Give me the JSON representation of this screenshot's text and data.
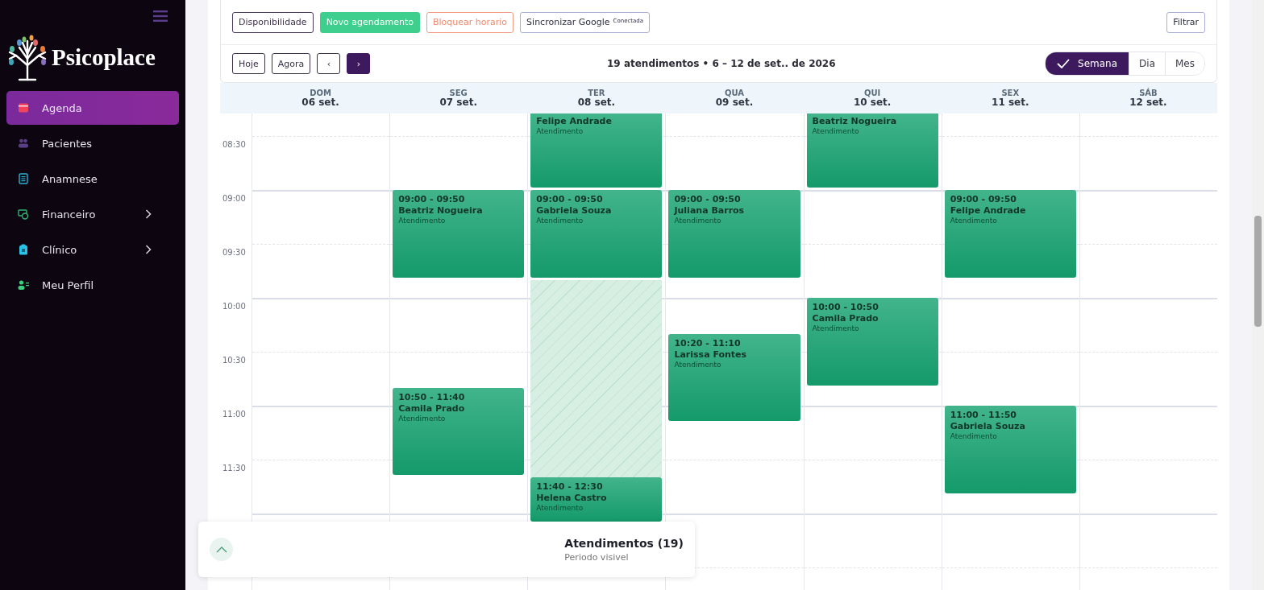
{
  "sidebar": {
    "brand": "Psicoplace",
    "items": [
      {
        "label": "Agenda",
        "selected": true,
        "expandable": false
      },
      {
        "label": "Pacientes",
        "selected": false,
        "expandable": false
      },
      {
        "label": "Anamnese",
        "selected": false,
        "expandable": false
      },
      {
        "label": "Financeiro",
        "selected": false,
        "expandable": true
      },
      {
        "label": "Clínico",
        "selected": false,
        "expandable": true
      },
      {
        "label": "Meu Perfil",
        "selected": false,
        "expandable": false
      }
    ]
  },
  "toolbar": {
    "actions": [
      {
        "label": "Disponibilidade",
        "kind": "outline"
      },
      {
        "label": "Novo agendamento",
        "kind": "primary"
      },
      {
        "label": "Bloquear horario",
        "kind": "danger"
      },
      {
        "label": "Sincronizar Google",
        "kind": "sync",
        "badge": "Conectada"
      }
    ],
    "filter": "Filtrar",
    "nav": [
      {
        "label": "Hoje",
        "kind": "text"
      },
      {
        "label": "Agora",
        "kind": "text"
      },
      {
        "label": "‹",
        "kind": "prev"
      },
      {
        "label": "›",
        "kind": "next"
      }
    ],
    "summary": "19 atendimentos • 6 – 12 de set.. de 2026",
    "views": [
      {
        "label": "Semana",
        "selected": true
      },
      {
        "label": "Dia",
        "selected": false
      },
      {
        "label": "Mes",
        "selected": false
      }
    ]
  },
  "calendar": {
    "times": [
      "08:30",
      "09:00",
      "09:30",
      "10:00",
      "10:30",
      "11:00",
      "11:30"
    ],
    "days": [
      {
        "weekday": "DOM",
        "date": "06 set."
      },
      {
        "weekday": "SEG",
        "date": "07 set.",
        "events": [
          {
            "kind": "appointment",
            "time": "09:00 - 09:50",
            "name": "Beatriz Nogueira",
            "type": "Atendimento"
          },
          {
            "kind": "appointment",
            "time": "10:50 - 11:40",
            "name": "Camila Prado",
            "type": "Atendimento"
          }
        ]
      },
      {
        "weekday": "TER",
        "date": "08 set.",
        "events": [
          {
            "kind": "continued",
            "name": "Felipe Andrade",
            "type": "Atendimento"
          },
          {
            "kind": "appointment",
            "time": "09:00 - 09:50",
            "name": "Gabriela Souza",
            "type": "Atendimento"
          },
          {
            "kind": "blocked"
          },
          {
            "kind": "appointment",
            "time": "11:40 - 12:30",
            "name": "Helena Castro",
            "type": "Atendimento"
          }
        ]
      },
      {
        "weekday": "QUA",
        "date": "09 set.",
        "events": [
          {
            "kind": "appointment",
            "time": "09:00 - 09:50",
            "name": "Juliana Barros",
            "type": "Atendimento"
          },
          {
            "kind": "appointment",
            "time": "10:20 - 11:10",
            "name": "Larissa Fontes",
            "type": "Atendimento"
          }
        ]
      },
      {
        "weekday": "QUI",
        "date": "10 set.",
        "events": [
          {
            "kind": "continued",
            "name": "Beatriz Nogueira",
            "type": "Atendimento"
          },
          {
            "kind": "appointment",
            "time": "10:00 - 10:50",
            "name": "Camila Prado",
            "type": "Atendimento"
          }
        ]
      },
      {
        "weekday": "SEX",
        "date": "11 set.",
        "events": [
          {
            "kind": "appointment",
            "time": "09:00 - 09:50",
            "name": "Felipe Andrade",
            "type": "Atendimento"
          },
          {
            "kind": "appointment",
            "time": "11:00 - 11:50",
            "name": "Gabriela Souza",
            "type": "Atendimento"
          }
        ]
      },
      {
        "weekday": "SÁB",
        "date": "12 set."
      }
    ]
  },
  "summary_panel": {
    "title": "Atendimentos (19)",
    "subtitle": "Periodo visivel"
  }
}
